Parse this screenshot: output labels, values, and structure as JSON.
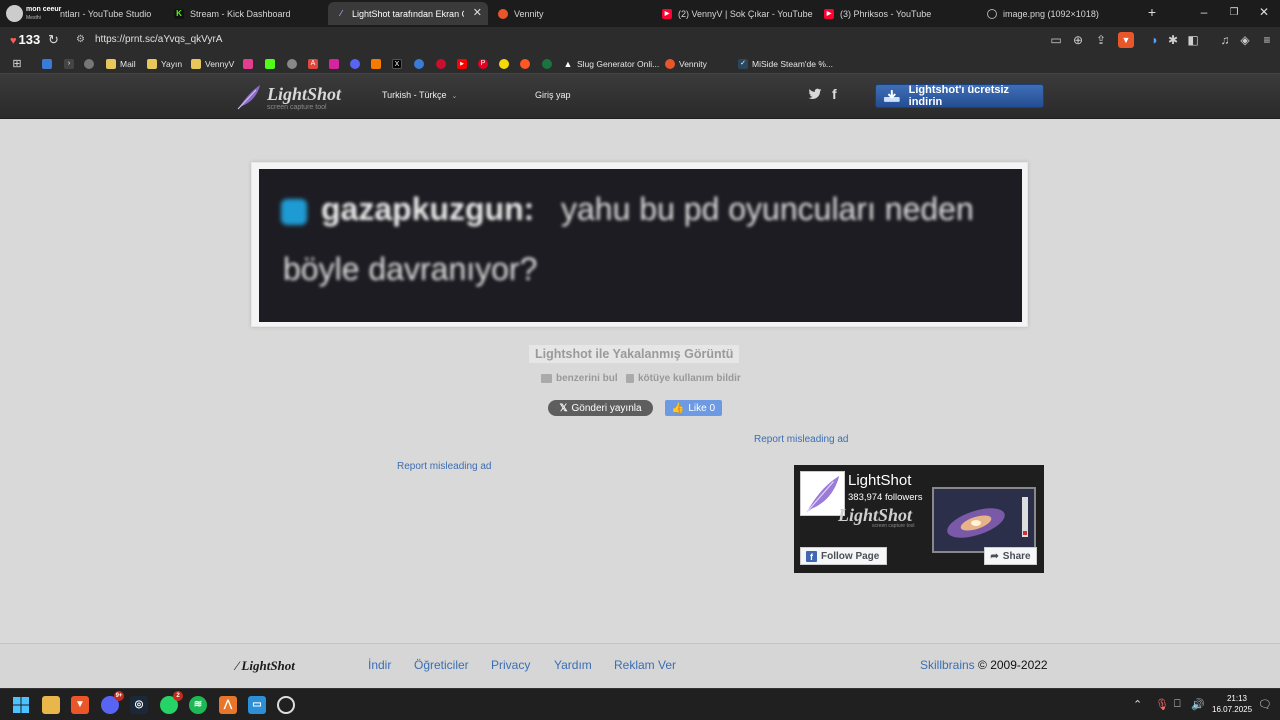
{
  "browser": {
    "profile": {
      "name": "mon ceeur",
      "sub": "Mesthi"
    },
    "tabs": [
      {
        "title": "ntları - YouTube Studio",
        "color": "#ff0000"
      },
      {
        "title": "Stream - Kick Dashboard",
        "color": "#53fc18"
      },
      {
        "title": "LightShot tarafından Ekran Görü",
        "color": "#9a7ad6",
        "active": true
      },
      {
        "title": "Vennity",
        "color": "#e8562a"
      },
      {
        "title": "(2) VennyV | Sok Çıkar - YouTube",
        "color": "#ff0000"
      },
      {
        "title": "(3) Phriksos - YouTube",
        "color": "#ff0000"
      },
      {
        "title": "image.png (1092×1018)",
        "color": "#9a9a9a"
      }
    ],
    "shield_count": "133",
    "url": "https://prnt.sc/aYvqs_qkVyrA",
    "bookmarks": [
      {
        "label": "",
        "color": "#3a7bd5"
      },
      {
        "label": "",
        "color": "#444"
      },
      {
        "label": "",
        "color": "#777"
      },
      {
        "label": "Mail",
        "color": "#e8c85a"
      },
      {
        "label": "Yayın",
        "color": "#e8c85a"
      },
      {
        "label": "VennyV",
        "color": "#e8c85a"
      },
      {
        "label": "",
        "color": "#e23d8f"
      },
      {
        "label": "",
        "color": "#53fc18"
      },
      {
        "label": "",
        "color": "#888"
      },
      {
        "label": "",
        "color": "#e0483e"
      },
      {
        "label": "",
        "color": "#d6249f"
      },
      {
        "label": "",
        "color": "#5865f2"
      },
      {
        "label": "",
        "color": "#f57c00"
      },
      {
        "label": "",
        "color": "#000"
      },
      {
        "label": "",
        "color": "#3a7bd5"
      },
      {
        "label": "",
        "color": "#c8102e"
      },
      {
        "label": "",
        "color": "#ff0000"
      },
      {
        "label": "",
        "color": "#e60023"
      },
      {
        "label": "",
        "color": "#f5d90a"
      },
      {
        "label": "",
        "color": "#ff5722"
      },
      {
        "label": "",
        "color": "#1b7340"
      },
      {
        "label": "Slug Generator Onli...",
        "color": "#000"
      },
      {
        "label": "Vennity",
        "color": "#e8562a"
      },
      {
        "label": "MiSide Steam'de %...",
        "color": "#2a475e"
      }
    ]
  },
  "site": {
    "logo_text": "LightShot",
    "logo_sub": "screen capture tool",
    "language": "Turkish - Türkçe",
    "login": "Giriş yap",
    "download_button": "Lightshot'ı ücretsiz indirin",
    "screenshot": {
      "user": "gazapkuzgun:",
      "line1": "yahu bu pd oyuncuları neden",
      "line2": "böyle davranıyor?"
    },
    "caption": "Lightshot ile Yakalanmış Görüntü",
    "find_similar": "benzerini bul",
    "report_abuse": "kötüye kullanım bildir",
    "tweet_button": "Gönderi yayınla",
    "like_button": "Like 0",
    "report_ad": "Report misleading ad",
    "fb_widget": {
      "name": "LightShot",
      "followers": "383,974 followers",
      "cover_logo": "LightShot",
      "cover_sub": "screen capture tool",
      "follow": "Follow Page",
      "share": "Share"
    },
    "footer": {
      "logo": "LightShot",
      "links": [
        "İndir",
        "Öğreticiler",
        "Privacy",
        "Yardım",
        "Reklam Ver"
      ],
      "company": "Skillbrains",
      "copyright": "© 2009-2022"
    }
  },
  "taskbar": {
    "time": "21:13",
    "date": "16.07.2025",
    "discord_badge": "9+",
    "whatsapp_badge": "2"
  }
}
